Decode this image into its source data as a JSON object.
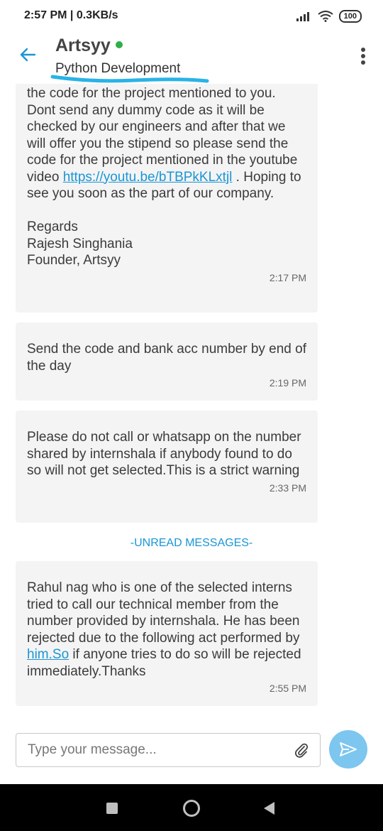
{
  "status_bar": {
    "text": "2:57 PM | 0.3KB/s",
    "battery": "100"
  },
  "header": {
    "title": "Artsyy",
    "subtitle": "Python Development",
    "online_color": "#2fae49"
  },
  "messages": [
    {
      "text_before_link": "the code for the project mentioned to you. Dont send any dummy code as it will be checked by our engineers and after that we will offer you the stipend so please send the code for the project mentioned in the youtube video ",
      "link": "https://youtu.be/bTBPkKLxtjl",
      "text_after_link": " . Hoping to see you soon as the part of our company.\n\nRegards\nRajesh Singhania\nFounder, Artsyy",
      "time": "2:17 PM"
    },
    {
      "text": "Send the code and bank acc number by end of the day",
      "time": "2:19 PM"
    },
    {
      "text": "Please do not call or whatsapp on the number shared by internshala if anybody found to do so will not get selected.This is a strict warning",
      "time": "2:33 PM"
    },
    {
      "text_before_link": "Rahul nag who is one of the selected interns tried to call our technical member from the number provided by internshala. He has been rejected due to the following act performed by ",
      "link": "him.So",
      "text_after_link": " if anyone tries to do so will be rejected immediately.Thanks",
      "time": "2:55 PM"
    }
  ],
  "divider": "-UNREAD MESSAGES-",
  "composer": {
    "placeholder": "Type your message..."
  },
  "colors": {
    "accent": "#1a96d4",
    "send_button": "#7cc6ef",
    "bubble": "#f4f4f5"
  }
}
